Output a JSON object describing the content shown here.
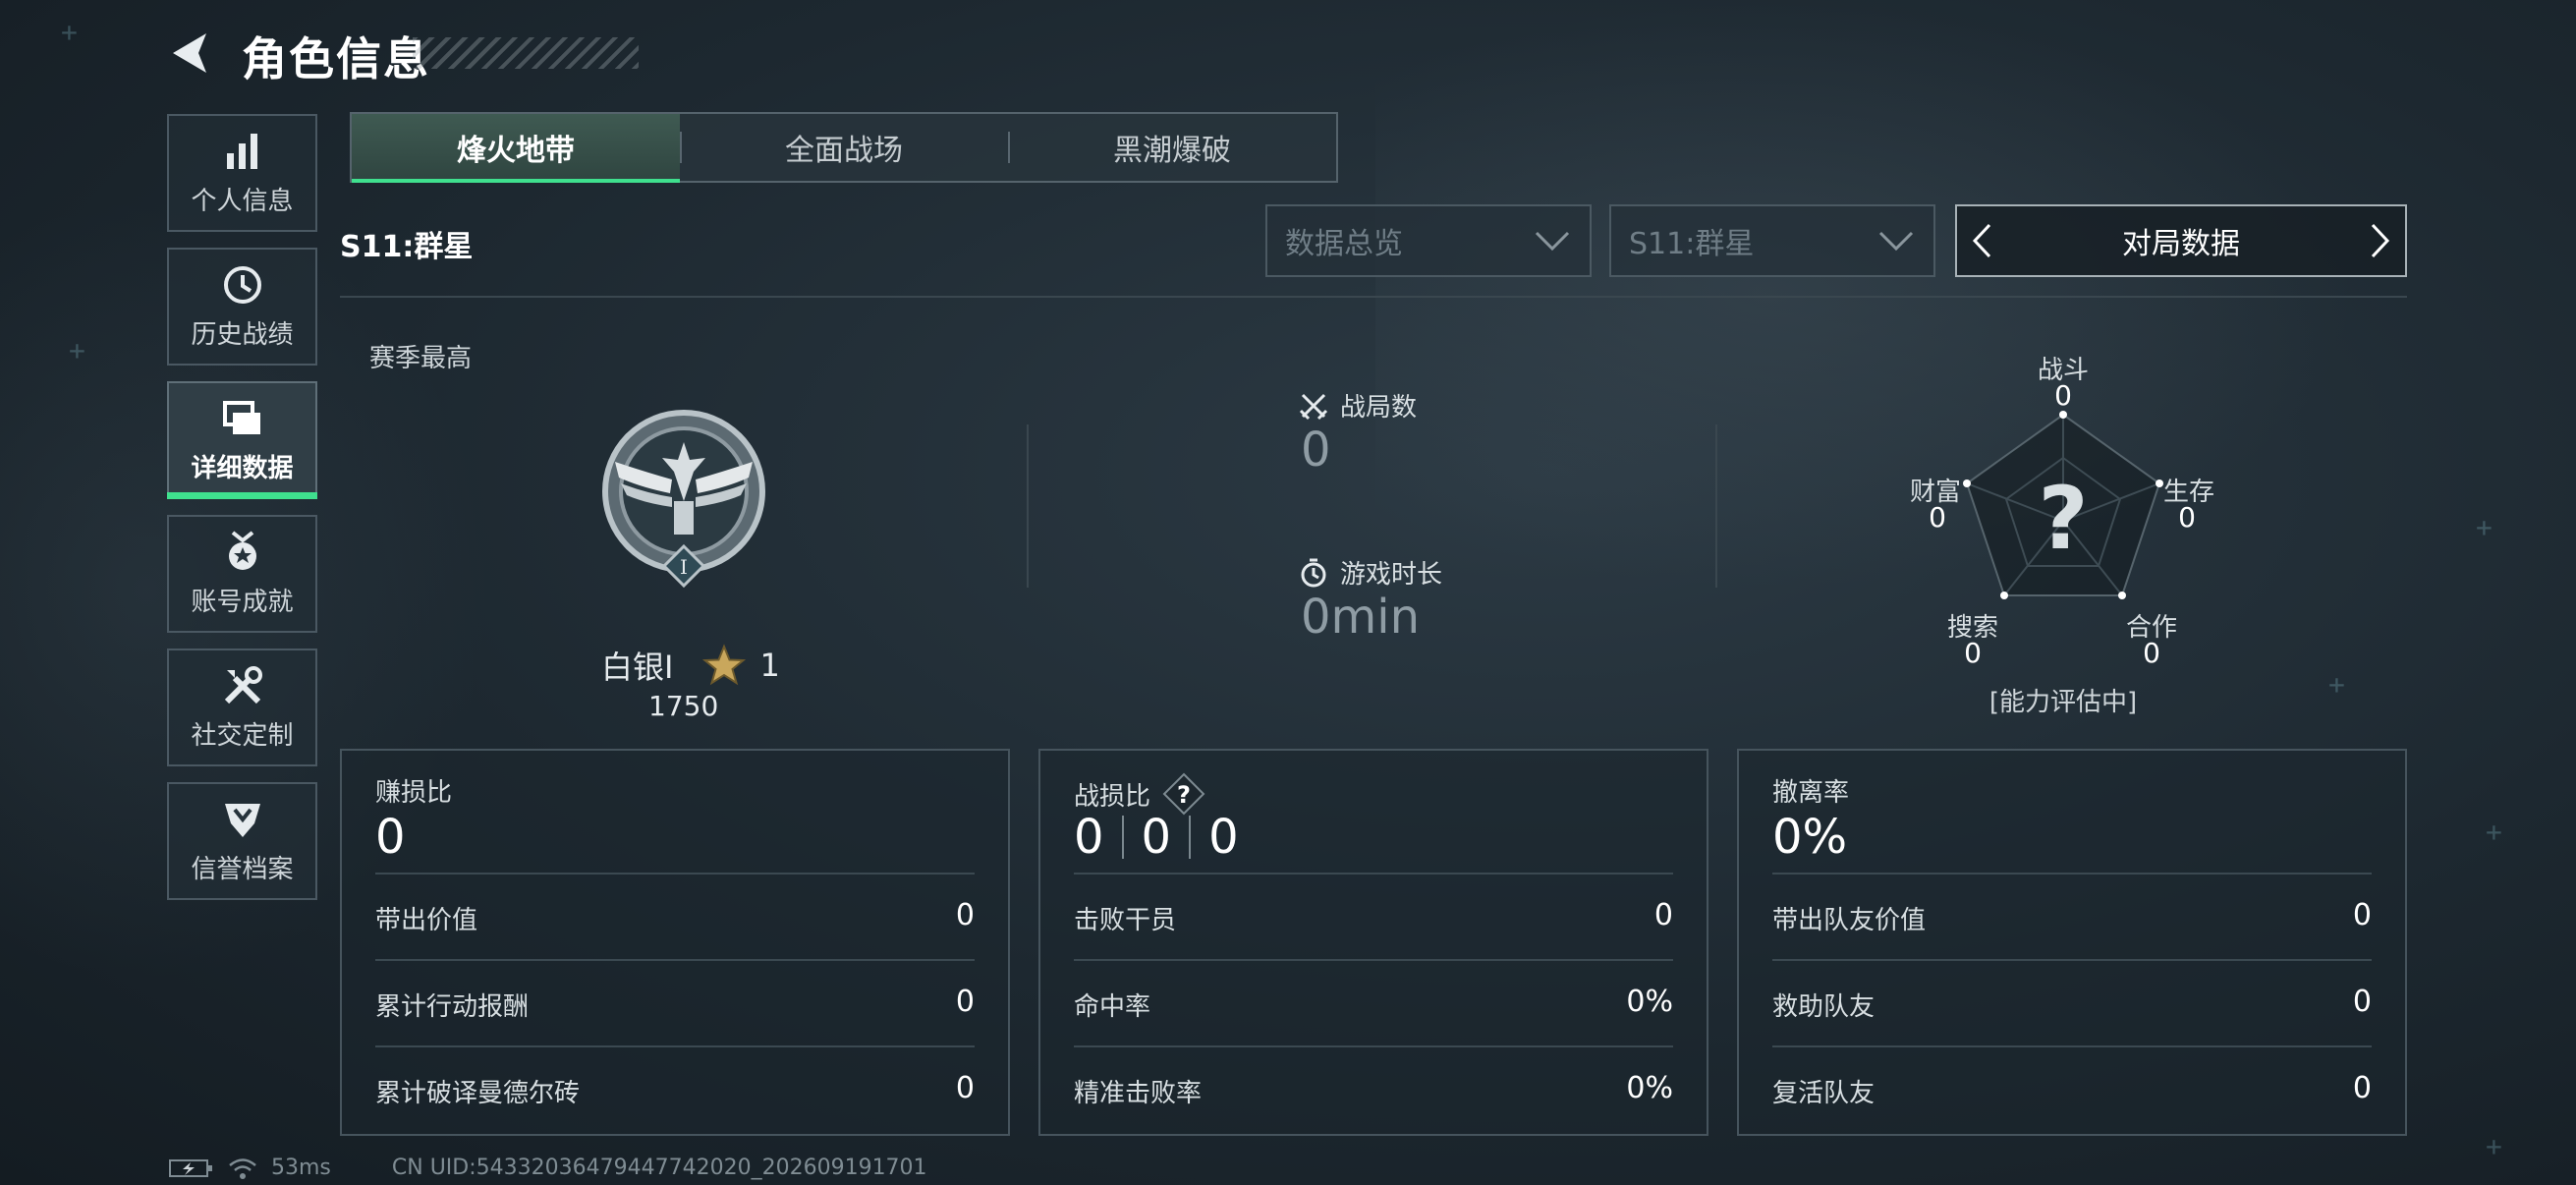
{
  "header": {
    "title": "角色信息"
  },
  "sidebar": {
    "items": [
      {
        "label": "个人信息",
        "icon": "bar-chart-icon"
      },
      {
        "label": "历史战绩",
        "icon": "history-clock-icon"
      },
      {
        "label": "详细数据",
        "icon": "data-cards-icon",
        "active": true
      },
      {
        "label": "账号成就",
        "icon": "medal-icon"
      },
      {
        "label": "社交定制",
        "icon": "tools-icon"
      },
      {
        "label": "信誉档案",
        "icon": "reputation-badge-icon"
      }
    ]
  },
  "mode_tabs": [
    {
      "label": "烽火地带",
      "active": true
    },
    {
      "label": "全面战场"
    },
    {
      "label": "黑潮爆破"
    }
  ],
  "season_title": "S11:群星",
  "filters": {
    "data_view": "数据总览",
    "season": "S11:群星",
    "switcher": "对局数据"
  },
  "rank": {
    "section_label": "赛季最高",
    "badge_numeral": "I",
    "tier": "白银I",
    "stars": "1",
    "points": "1750"
  },
  "summary": {
    "matches_label": "战局数",
    "matches_value": "0",
    "playtime_label": "游戏时长",
    "playtime_value": "0min"
  },
  "radar": {
    "center": "?",
    "status": "[能力评估中]",
    "axes": [
      {
        "label": "战斗",
        "value": "0"
      },
      {
        "label": "生存",
        "value": "0"
      },
      {
        "label": "合作",
        "value": "0"
      },
      {
        "label": "搜索",
        "value": "0"
      },
      {
        "label": "财富",
        "value": "0"
      }
    ]
  },
  "cards": {
    "profit": {
      "title": "赚损比",
      "value": "0",
      "rows": [
        {
          "label": "带出价值",
          "value": "0"
        },
        {
          "label": "累计行动报酬",
          "value": "0"
        },
        {
          "label": "累计破译曼德尔砖",
          "value": "0"
        }
      ]
    },
    "combat": {
      "title": "战损比",
      "help_icon": "?",
      "values": [
        "0",
        "0",
        "0"
      ],
      "rows": [
        {
          "label": "击败干员",
          "value": "0"
        },
        {
          "label": "命中率",
          "value": "0%"
        },
        {
          "label": "精准击败率",
          "value": "0%"
        }
      ]
    },
    "extract": {
      "title": "撤离率",
      "value": "0%",
      "rows": [
        {
          "label": "带出队友价值",
          "value": "0"
        },
        {
          "label": "救助队友",
          "value": "0"
        },
        {
          "label": "复活队友",
          "value": "0"
        }
      ]
    }
  },
  "footer": {
    "ping": "53ms",
    "uid": "CN UID:54332036479447742020_202609191701"
  },
  "colors": {
    "accent": "#3fe08e",
    "background": "#1d2830"
  }
}
